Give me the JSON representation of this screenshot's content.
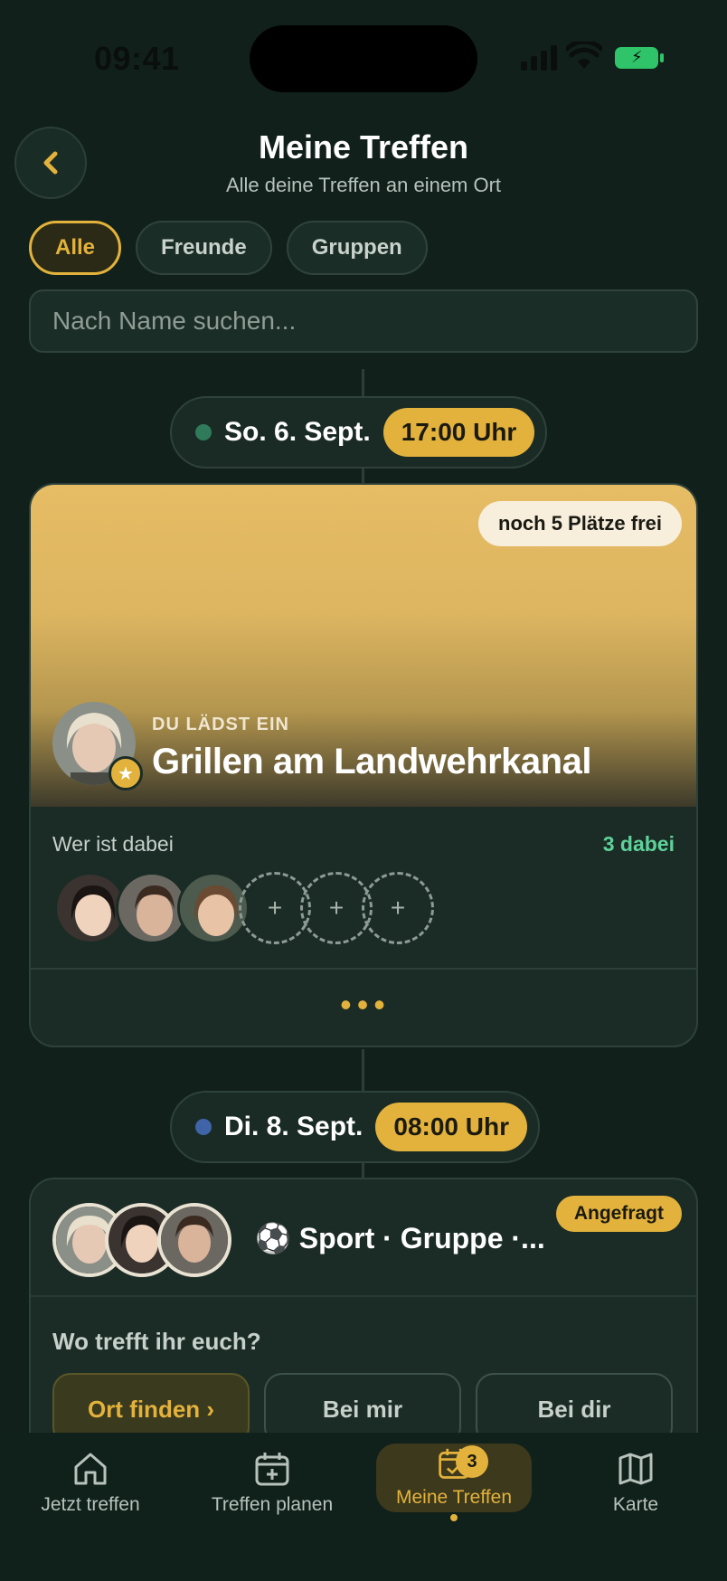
{
  "status_bar": {
    "time": "09:41"
  },
  "header": {
    "title": "Meine Treffen",
    "subtitle": "Alle deine Treffen an einem Ort"
  },
  "filters": [
    {
      "label": "Alle",
      "active": true
    },
    {
      "label": "Freunde",
      "active": false
    },
    {
      "label": "Gruppen",
      "active": false
    }
  ],
  "search": {
    "placeholder": "Nach Name suchen..."
  },
  "events": [
    {
      "date": "So. 6. Sept.",
      "time": "17:00 Uhr",
      "dot_color": "#2f7a5a",
      "spots": "noch 5 Plätze frei",
      "role": "DU LÄDST EIN",
      "title": "Grillen am Landwehrkanal",
      "who_label": "Wer ist dabei",
      "who_count": "3 dabei",
      "more": "•••"
    },
    {
      "date": "Di. 8. Sept.",
      "time": "08:00 Uhr",
      "dot_color": "#3f64a8",
      "status": "Angefragt",
      "title": "⚽ Sport · Gruppe ·...",
      "where_label": "Wo trefft ihr euch?",
      "place_options": [
        "Ort finden ›",
        "Bei mir",
        "Bei dir"
      ]
    }
  ],
  "tabbar": {
    "items": [
      {
        "label": "Jetzt treffen",
        "icon": "home-icon"
      },
      {
        "label": "Treffen planen",
        "icon": "calendar-plus-icon"
      },
      {
        "label": "Meine Treffen",
        "icon": "calendar-check-icon",
        "badge": "3",
        "active": true
      },
      {
        "label": "Karte",
        "icon": "map-icon"
      }
    ]
  },
  "colors": {
    "accent": "#e3b23c",
    "background": "#11201b",
    "success": "#5fd19a"
  }
}
